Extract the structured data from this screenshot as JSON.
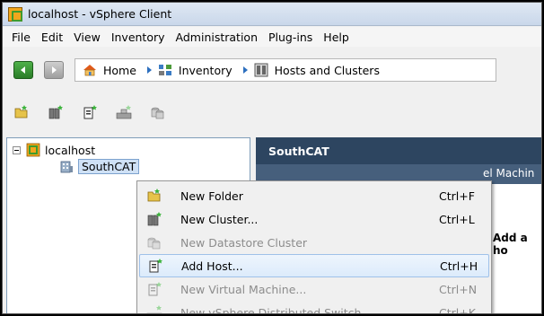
{
  "window": {
    "title": "localhost - vSphere Client"
  },
  "menubar": {
    "items": [
      "File",
      "Edit",
      "View",
      "Inventory",
      "Administration",
      "Plug-ins",
      "Help"
    ]
  },
  "navbar": {
    "breadcrumbs": [
      {
        "label": "Home",
        "icon": "home-icon"
      },
      {
        "label": "Inventory",
        "icon": "inventory-icon"
      },
      {
        "label": "Hosts and Clusters",
        "icon": "hosts-clusters-icon"
      }
    ]
  },
  "toolbar": {
    "icons": [
      "new-folder-icon",
      "new-cluster-icon",
      "add-host-icon",
      "new-vm-icon",
      "new-datastore-cluster-icon"
    ]
  },
  "tree": {
    "root": {
      "label": "localhost"
    },
    "child": {
      "label": "SouthCAT"
    }
  },
  "content": {
    "header": "SouthCAT",
    "tab_fragment": "el Machin",
    "text_fragment": "Add a ho"
  },
  "context_menu": {
    "items": [
      {
        "label": "New Folder",
        "shortcut": "Ctrl+F",
        "enabled": true,
        "icon": "new-folder-icon"
      },
      {
        "label": "New Cluster...",
        "shortcut": "Ctrl+L",
        "enabled": true,
        "icon": "new-cluster-icon"
      },
      {
        "label": "New Datastore Cluster",
        "shortcut": "",
        "enabled": false,
        "icon": "new-datastore-cluster-icon"
      },
      {
        "label": "Add Host...",
        "shortcut": "Ctrl+H",
        "enabled": true,
        "highlighted": true,
        "icon": "add-host-icon"
      },
      {
        "label": "New Virtual Machine...",
        "shortcut": "Ctrl+N",
        "enabled": false,
        "icon": "new-vm-icon"
      },
      {
        "label": "New vSphere Distributed Switch...",
        "shortcut": "Ctrl+K",
        "enabled": false,
        "icon": "new-dvswitch-icon"
      }
    ]
  },
  "colors": {
    "header_bg": "#2d4560",
    "tab_bg": "#465f7c",
    "selection": "#cfe1f6",
    "back_button": "#3a9a35"
  }
}
